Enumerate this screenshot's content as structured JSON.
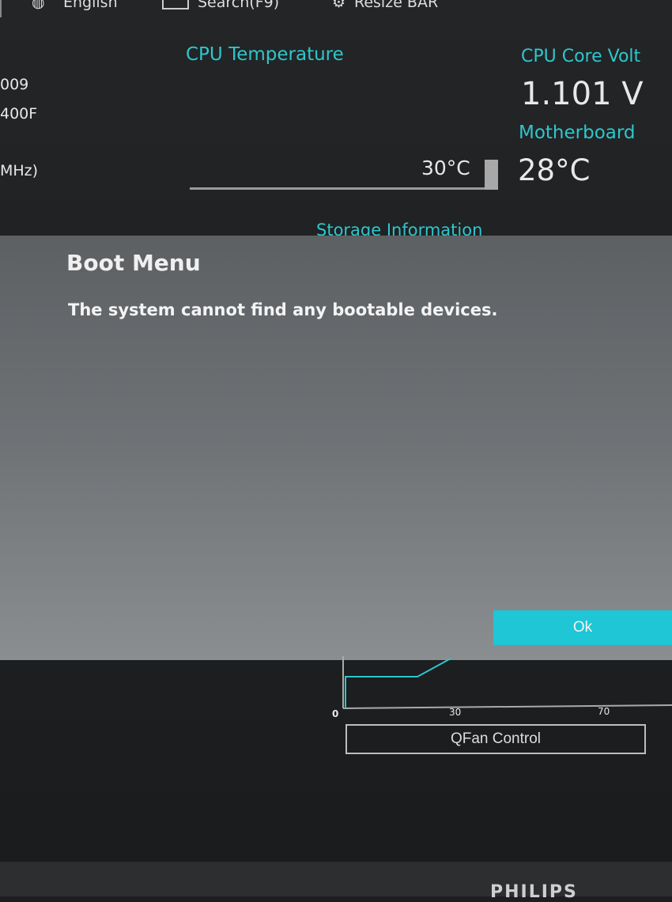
{
  "topbar": {
    "language": "English",
    "search": "Search(F9)",
    "resize_bar": "Resize BAR"
  },
  "left_panel": {
    "line1": "009",
    "line2": "400F",
    "line3": "MHz)"
  },
  "cpu_temperature": {
    "label": "CPU Temperature",
    "value": "30°C"
  },
  "cpu_core_voltage": {
    "label": "CPU Core Volt",
    "value": "1.101 V"
  },
  "motherboard_temp": {
    "label": "Motherboard",
    "value": "28°C"
  },
  "storage": {
    "label": "Storage Information"
  },
  "dialog": {
    "title": "Boot Menu",
    "message": "The system cannot find any bootable devices.",
    "ok_label": "Ok"
  },
  "fan_chart": {
    "ticks": [
      "0",
      "30",
      "70"
    ],
    "button_label": "QFan Control"
  },
  "monitor": {
    "brand": "PHILIPS"
  },
  "colors": {
    "accent": "#2fc6cc",
    "ok_button": "#1ec6d6",
    "dialog_bg": "#6f7376"
  }
}
